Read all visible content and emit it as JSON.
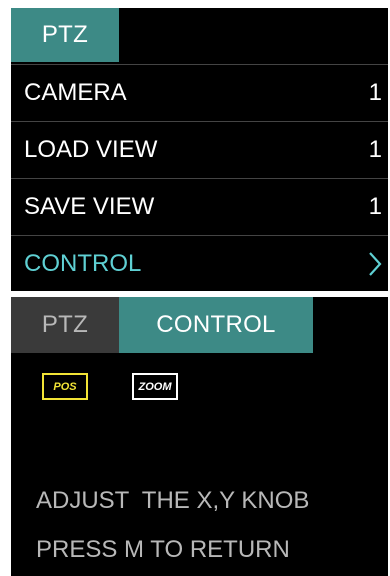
{
  "menu_panel": {
    "tab": "PTZ",
    "rows": [
      {
        "label": "CAMERA",
        "value": "1"
      },
      {
        "label": "LOAD VIEW",
        "value": "1"
      },
      {
        "label": "SAVE VIEW",
        "value": "1"
      },
      {
        "label": "CONTROL",
        "icon": "chevron-right-icon"
      }
    ],
    "colors": {
      "tab_active": "#3d8a86",
      "selected_row_text": "#5fd0d3"
    }
  },
  "control_panel": {
    "tabs": [
      "PTZ",
      "CONTROL"
    ],
    "mode_buttons": [
      {
        "label": "POS",
        "selected": true,
        "color": "#f2e436"
      },
      {
        "label": "ZOOM",
        "selected": false,
        "color": "#ffffff"
      }
    ],
    "instructions": [
      "ADJUST  THE X,Y KNOB",
      "PRESS M TO RETURN"
    ]
  }
}
